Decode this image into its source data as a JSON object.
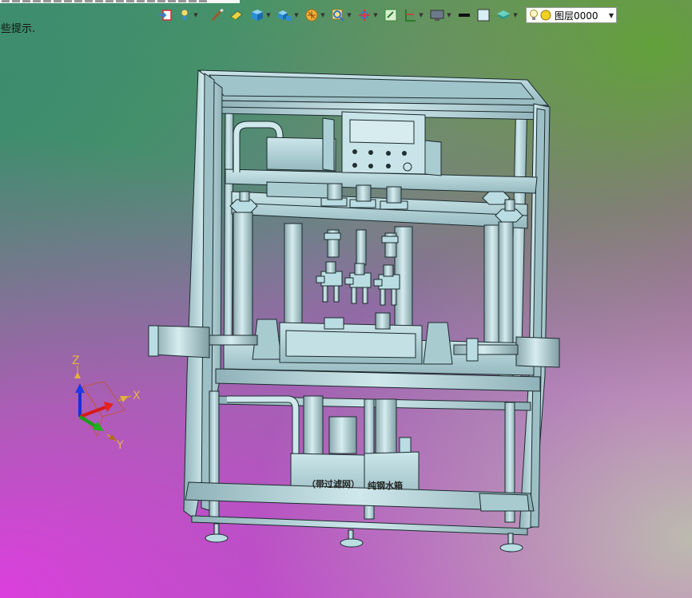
{
  "status_hint": "些提示.",
  "toolbar": {
    "layer_name": "图层0000",
    "buttons": [
      {
        "icon": "import-icon"
      },
      {
        "icon": "light-bulb-small-icon"
      },
      {
        "icon": "brush-icon"
      },
      {
        "icon": "eraser-icon"
      },
      {
        "icon": "cube-blue-icon"
      },
      {
        "icon": "cubes-icon"
      },
      {
        "icon": "filter-icon"
      },
      {
        "icon": "zoom-icon"
      },
      {
        "icon": "orient-icon"
      },
      {
        "icon": "fit-view-icon"
      },
      {
        "icon": "grid-icon"
      },
      {
        "icon": "display-mode-icon"
      },
      {
        "icon": "line-weight-icon"
      },
      {
        "icon": "color-swatch-icon"
      },
      {
        "icon": "layer-stack-icon"
      }
    ]
  },
  "triad": {
    "x_label": "X",
    "y_label": "Y",
    "z_label": "Z"
  },
  "model": {
    "tank_label_left": "（带过滤网）",
    "tank_label_right": "纯钢水箱"
  },
  "colors": {
    "model_fill": "#b9dde3",
    "model_edge": "#1c2b2e",
    "layer_bulb": "#f2d024"
  }
}
